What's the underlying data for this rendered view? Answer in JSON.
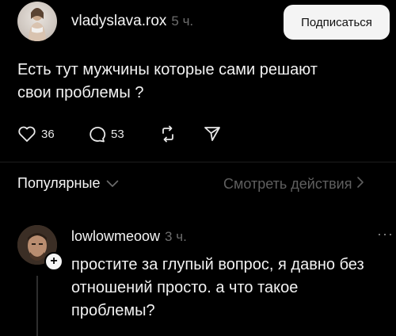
{
  "post": {
    "username": "vladyslava.rox",
    "time": "5 ч.",
    "subscribe_label": "Подписаться",
    "text_line1": "Есть тут мужчины которые сами решают",
    "text_line2": "свои проблемы ?",
    "likes": "36",
    "comments": "53"
  },
  "tabs": {
    "popular_label": "Популярные",
    "view_actions_label": "Смотреть действия"
  },
  "reply": {
    "username": "lowlowmeoow",
    "time": "3 ч.",
    "more": "···",
    "plus": "+",
    "text_line1": "простите за глупый вопрос, я давно без",
    "text_line2": "отношений просто. а что такое",
    "text_line3": "проблемы?"
  },
  "icons": {
    "like": "heart-icon",
    "comment": "comment-icon",
    "repost": "repost-icon",
    "share": "share-icon"
  }
}
